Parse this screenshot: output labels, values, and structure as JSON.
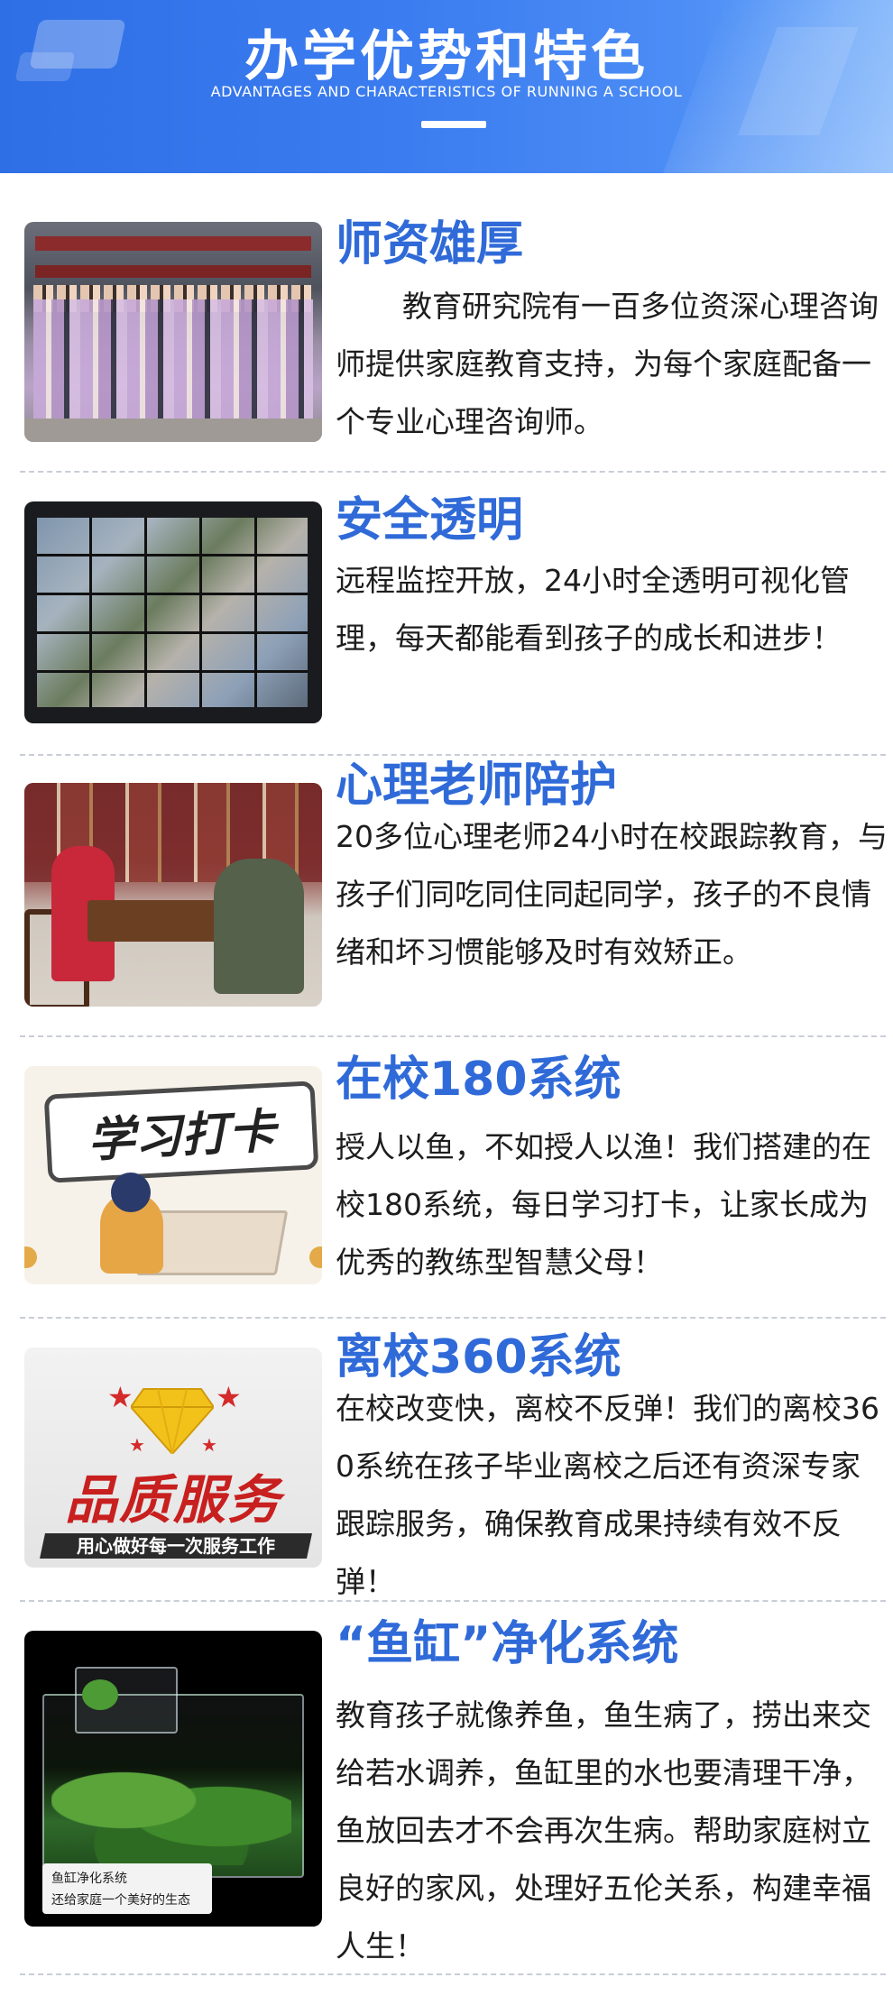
{
  "header": {
    "title": "办学优势和特色",
    "subtitle": "ADVANTAGES AND CHARACTERISTICS OF RUNNING A SCHOOL"
  },
  "features": [
    {
      "title": "师资雄厚",
      "text": "教育研究院有一百多位资深心理咨询师提供家庭教育支持，为每个家庭配备一个专业心理咨询师。",
      "image": "group-photo-teachers"
    },
    {
      "title": "安全透明",
      "text": "远程监控开放，24小时全透明可视化管理，每天都能看到孩子的成长和进步！",
      "image": "surveillance-monitor-wall"
    },
    {
      "title": "心理老师陪护",
      "text": "20多位心理老师24小时在校跟踪教育，与孩子们同吃同住同起同学，孩子的不良情绪和坏习惯能够及时有效矫正。",
      "image": "teacher-student-counseling"
    },
    {
      "title": "在校180系统",
      "text": "授人以鱼，不如授人以渔！我们搭建的在校180系统，每日学习打卡，让家长成为优秀的教练型智慧父母！",
      "image": "study-checkin-illustration",
      "image_text": "学习打卡"
    },
    {
      "title": "离校360系统",
      "text": "在校改变快，离校不反弹！我们的离校360系统在孩子毕业离校之后还有资深专家跟踪服务，确保教育成果持续有效不反弹！",
      "image": "quality-service-sign",
      "image_text": "品质服务",
      "image_caption": "用心做好每一次服务工作"
    },
    {
      "title": "“鱼缸”净化系统",
      "text": "教育孩子就像养鱼，鱼生病了，捞出来交给若水调养，鱼缸里的水也要清理干净，鱼放回去才不会再次生病。帮助家庭树立良好的家风，处理好五伦关系，构建幸福人生！",
      "image": "fish-tank-aquarium",
      "image_label_line1": "鱼缸净化系统",
      "image_label_line2": "还给家庭一个美好的生态"
    }
  ],
  "colors": {
    "header_blue": "#2f6fe6",
    "title_blue": "#2f6ad8",
    "body_text": "#1d1d1d"
  }
}
